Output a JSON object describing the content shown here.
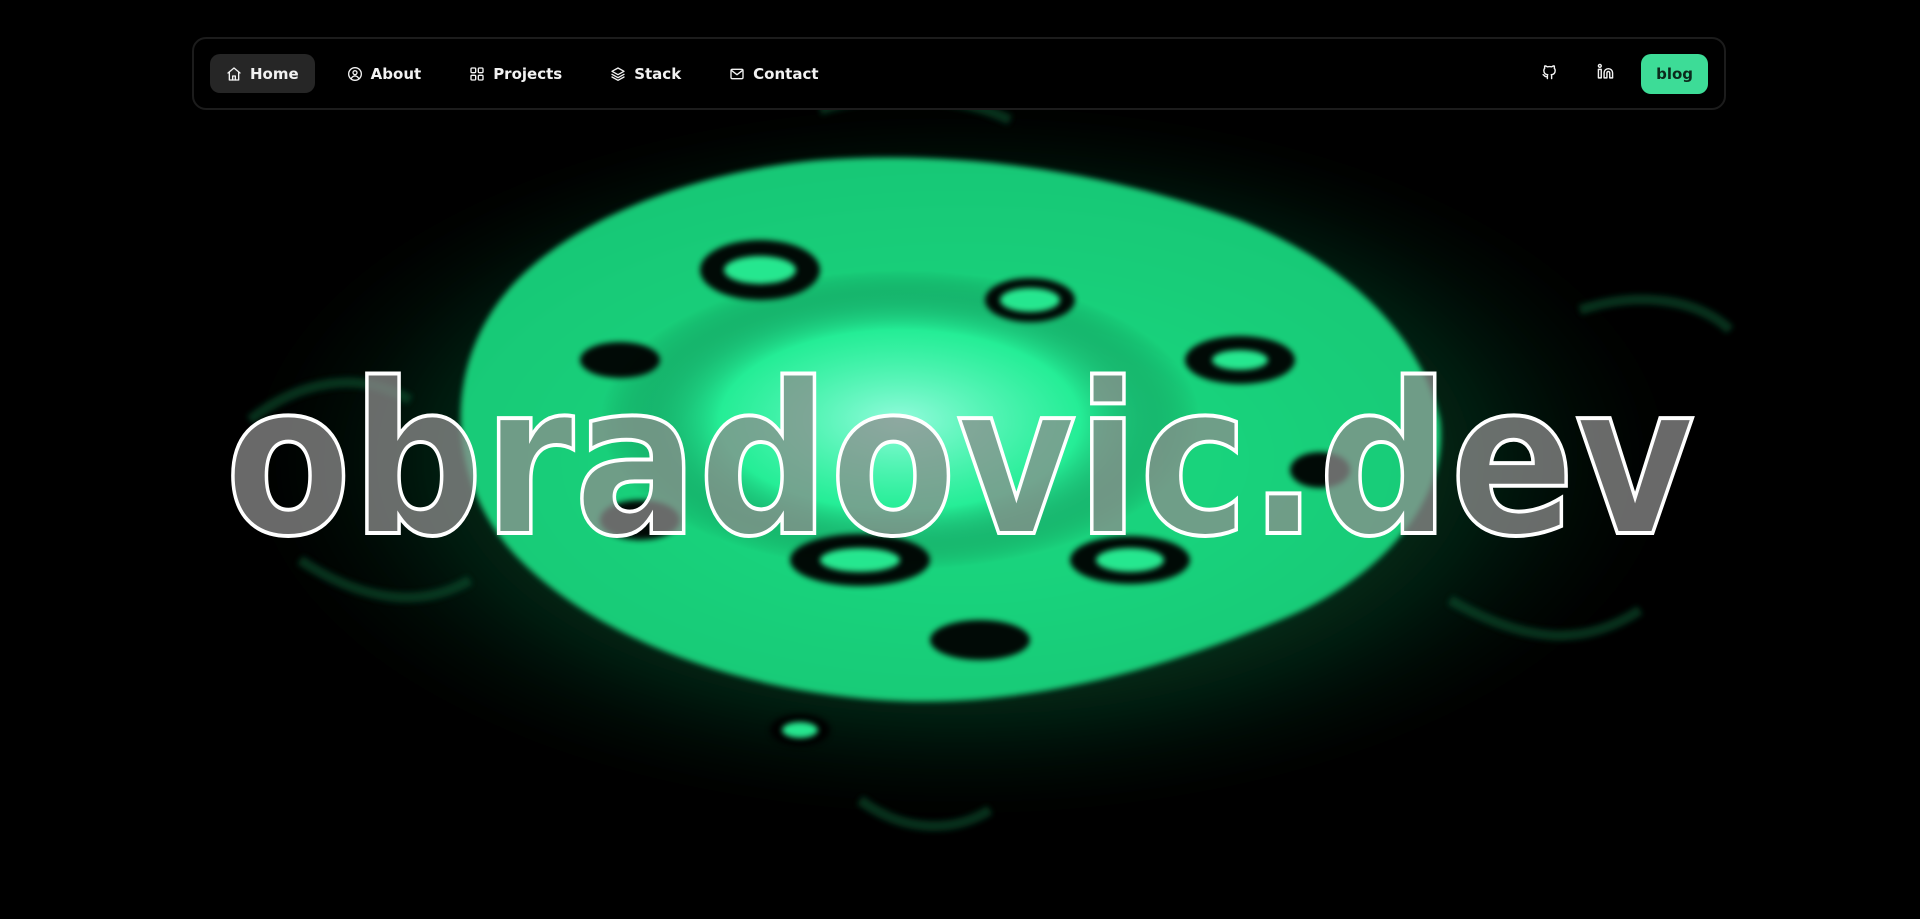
{
  "nav": {
    "items": [
      {
        "label": "Home",
        "icon": "home-icon",
        "active": true
      },
      {
        "label": "About",
        "icon": "user-circle-icon",
        "active": false
      },
      {
        "label": "Projects",
        "icon": "grid-icon",
        "active": false
      },
      {
        "label": "Stack",
        "icon": "layers-icon",
        "active": false
      },
      {
        "label": "Contact",
        "icon": "mail-icon",
        "active": false
      }
    ],
    "social": [
      {
        "name": "github-icon"
      },
      {
        "name": "linkedin-icon"
      }
    ],
    "blog_label": "blog"
  },
  "hero": {
    "title": "obradovic.dev"
  },
  "colors": {
    "accent": "#3ddc97",
    "glow": "#1cff9a",
    "background": "#000000",
    "nav_active": "#262626"
  }
}
